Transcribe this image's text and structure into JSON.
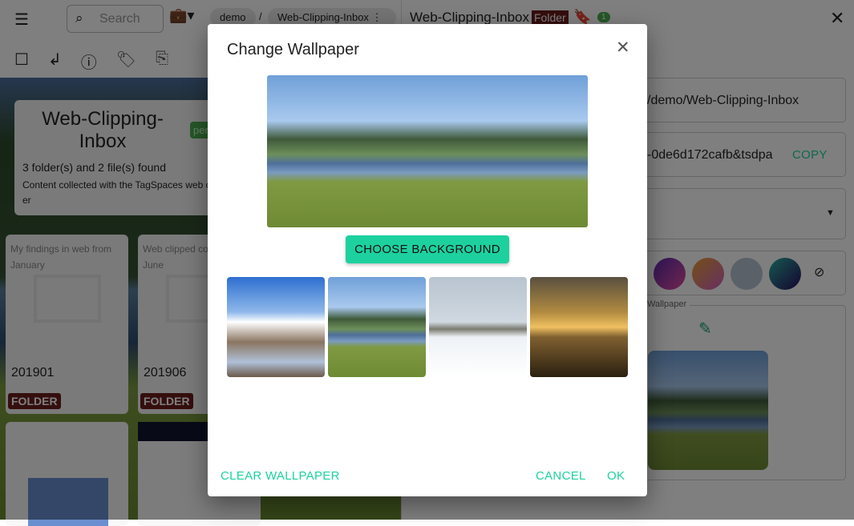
{
  "topbar": {
    "search_placeholder": "Search",
    "breadcrumb": [
      "demo",
      "Web-Clipping-Inbox"
    ],
    "separator": "/"
  },
  "folder_header": {
    "title": "Web-Clipping-Inbox",
    "tag": "per",
    "summary": "3 folder(s) and 2 file(s) found",
    "description": "Content collected with the TagSpaces web clipp",
    "description_tail": "er"
  },
  "folders": [
    {
      "description": "My findings in web from January",
      "name": "201901",
      "badge": "FOLDER"
    },
    {
      "description": "Web clipped content from June",
      "name": "201906",
      "badge": "FOLDER"
    }
  ],
  "right_panel": {
    "title": "Web-Clipping-Inbox",
    "type_badge": "Folder",
    "count_badge": "1",
    "path": "/demo/Web-Clipping-Inbox",
    "link": "-0de6d172cafb&tsdpa",
    "copy_label": "COPY",
    "wallpaper_legend": "Wallpaper"
  },
  "dialog": {
    "title": "Change Wallpaper",
    "choose_label": "CHOOSE BACKGROUND",
    "clear_label": "CLEAR WALLPAPER",
    "cancel_label": "CANCEL",
    "ok_label": "OK"
  },
  "colors": {
    "accent": "#1dd19f",
    "folder_badge": "#6b1d1d",
    "count_badge": "#4caf50"
  }
}
